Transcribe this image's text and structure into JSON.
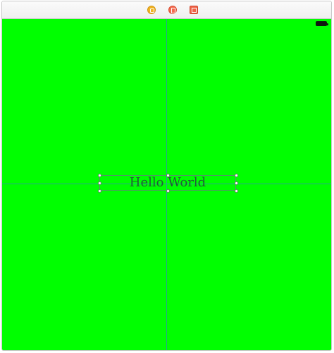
{
  "scene": {
    "label_text": "Hello World",
    "canvas_color": "#00ff00",
    "guide_color": "#2f8fb0"
  },
  "scene_dock": {
    "icons": [
      "view-controller-icon",
      "first-responder-icon",
      "exit-icon"
    ]
  },
  "status_bar": {
    "icon": "battery-icon"
  }
}
